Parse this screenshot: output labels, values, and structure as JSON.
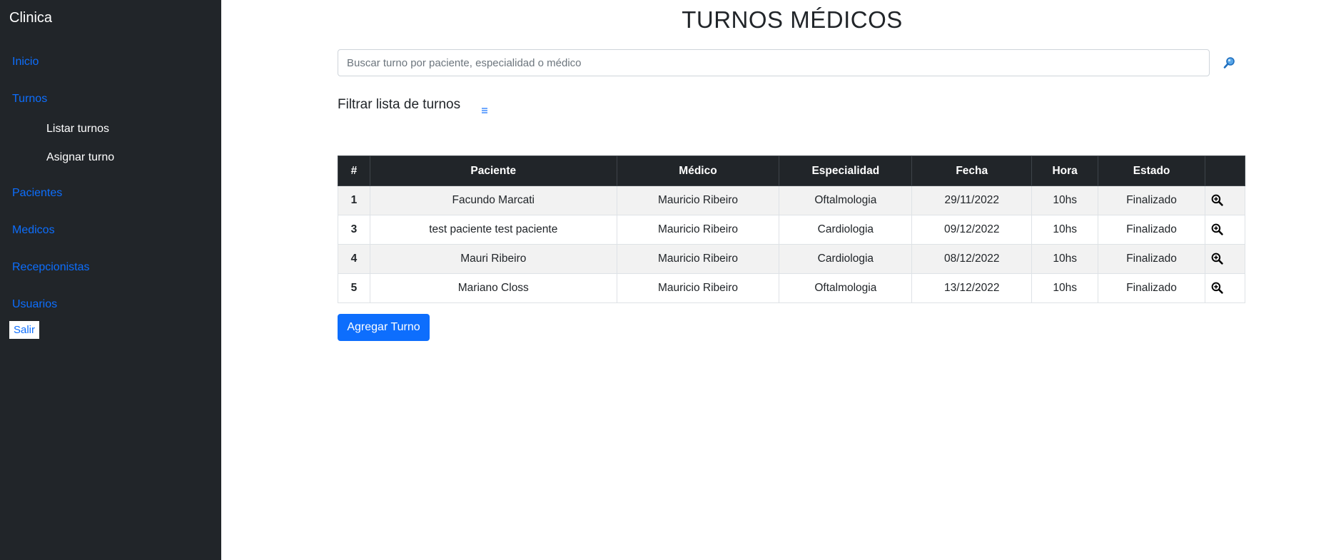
{
  "sidebar": {
    "brand": "Clinica",
    "nav": {
      "inicio": "Inicio",
      "turnos": "Turnos",
      "listar_turnos": "Listar turnos",
      "asignar_turno": "Asignar turno",
      "pacientes": "Pacientes",
      "medicos": "Medicos",
      "recepcionistas": "Recepcionistas",
      "usuarios": "Usuarios"
    },
    "logout_label": "Salir"
  },
  "main": {
    "title": "TURNOS MÉDICOS",
    "search": {
      "placeholder": "Buscar turno por paciente, especialidad o médico",
      "value": ""
    },
    "filter_title": "Filtrar lista de turnos",
    "table": {
      "headers": [
        "#",
        "Paciente",
        "Médico",
        "Especialidad",
        "Fecha",
        "Hora",
        "Estado",
        ""
      ],
      "rows": [
        {
          "num": "1",
          "paciente": "Facundo Marcati",
          "medico": "Mauricio Ribeiro",
          "especialidad": "Oftalmologia",
          "fecha": "29/11/2022",
          "hora": "10hs",
          "estado": "Finalizado"
        },
        {
          "num": "3",
          "paciente": "test paciente test paciente",
          "medico": "Mauricio Ribeiro",
          "especialidad": "Cardiologia",
          "fecha": "09/12/2022",
          "hora": "10hs",
          "estado": "Finalizado"
        },
        {
          "num": "4",
          "paciente": "Mauri Ribeiro",
          "medico": "Mauricio Ribeiro",
          "especialidad": "Cardiologia",
          "fecha": "08/12/2022",
          "hora": "10hs",
          "estado": "Finalizado"
        },
        {
          "num": "5",
          "paciente": "Mariano Closs",
          "medico": "Mauricio Ribeiro",
          "especialidad": "Oftalmologia",
          "fecha": "13/12/2022",
          "hora": "10hs",
          "estado": "Finalizado"
        }
      ]
    },
    "add_button_label": "Agregar Turno"
  },
  "icons": {
    "search": "magnifier-icon",
    "filter": "list-icon",
    "row_action": "zoom-in-icon"
  },
  "colors": {
    "sidebar_bg": "#212529",
    "link": "#0d6efd",
    "primary_button": "#0d6efd",
    "table_header_bg": "#212529",
    "striped_row": "#f2f2f2"
  }
}
